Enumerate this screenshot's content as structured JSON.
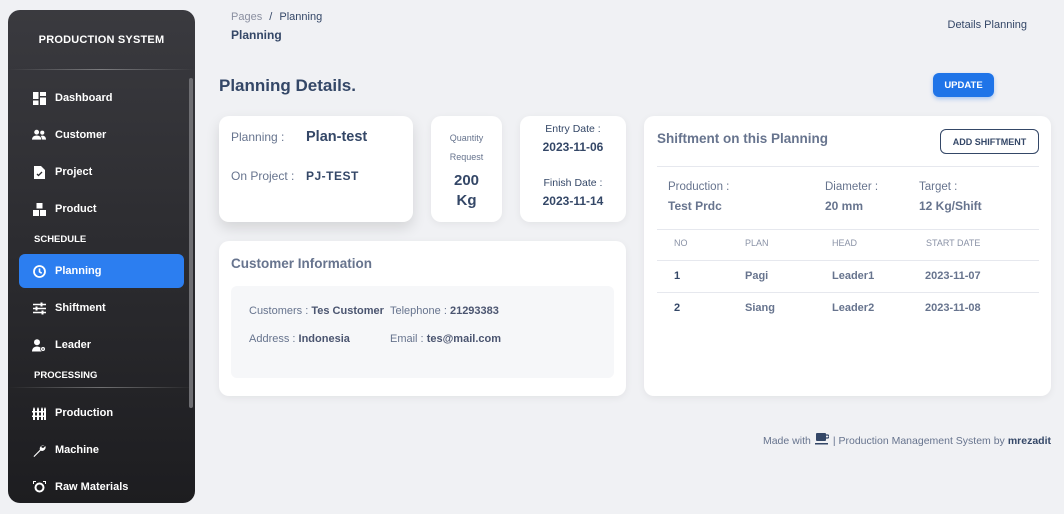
{
  "sidebar": {
    "brand": "PRODUCTION SYSTEM",
    "items": [
      {
        "label": "Dashboard",
        "icon": "dashboard-icon"
      },
      {
        "label": "Customer",
        "icon": "users-icon"
      },
      {
        "label": "Project",
        "icon": "file-icon"
      },
      {
        "label": "Product",
        "icon": "boxes-icon"
      }
    ],
    "section_schedule": "SCHEDULE",
    "schedule_items": [
      {
        "label": "Planning",
        "icon": "clock-icon",
        "active": true
      },
      {
        "label": "Shiftment",
        "icon": "sliders-icon"
      },
      {
        "label": "Leader",
        "icon": "user-gear-icon"
      }
    ],
    "section_processing": "PROCESSING",
    "processing_items": [
      {
        "label": "Production",
        "icon": "fence-icon"
      },
      {
        "label": "Machine",
        "icon": "wrench-icon"
      },
      {
        "label": "Raw Materials",
        "icon": "gear-box-icon"
      }
    ]
  },
  "header": {
    "breadcrumb_root": "Pages",
    "breadcrumb_sep": "/",
    "breadcrumb_current": "Planning",
    "title": "Planning",
    "right_text": "Details Planning"
  },
  "page": {
    "title": "Planning Details.",
    "update_button": "UPDATE"
  },
  "planning_card": {
    "planning_label": "Planning :",
    "planning_value": "Plan-test",
    "project_label": "On Project :",
    "project_value": "PJ-TEST"
  },
  "quantity_card": {
    "label_line1": "Quantity",
    "label_line2": "Request",
    "value": "200",
    "unit": "Kg"
  },
  "date_card": {
    "entry_label": "Entry Date :",
    "entry_value": "2023-11-06",
    "finish_label": "Finish Date :",
    "finish_value": "2023-11-14"
  },
  "customer_card": {
    "title": "Customer Information",
    "customers_label": "Customers :",
    "customers_value": "Tes Customer",
    "telephone_label": "Telephone :",
    "telephone_value": "21293383",
    "address_label": "Address :",
    "address_value": "Indonesia",
    "email_label": "Email :",
    "email_value": "tes@mail.com"
  },
  "shiftment_card": {
    "title": "Shiftment on this Planning",
    "add_button": "ADD SHIFTMENT",
    "production_label": "Production :",
    "production_value": "Test Prdc",
    "diameter_label": "Diameter :",
    "diameter_value": "20 mm",
    "target_label": "Target :",
    "target_value": "12 Kg/Shift",
    "columns": [
      "NO",
      "PLAN",
      "HEAD",
      "START DATE"
    ],
    "rows": [
      {
        "no": "1",
        "plan": "Pagi",
        "head": "Leader1",
        "start_date": "2023-11-07"
      },
      {
        "no": "2",
        "plan": "Siang",
        "head": "Leader2",
        "start_date": "2023-11-08"
      }
    ]
  },
  "footer": {
    "made_with": "Made with",
    "middle": "| Production Management System by",
    "author": "mrezadit"
  }
}
